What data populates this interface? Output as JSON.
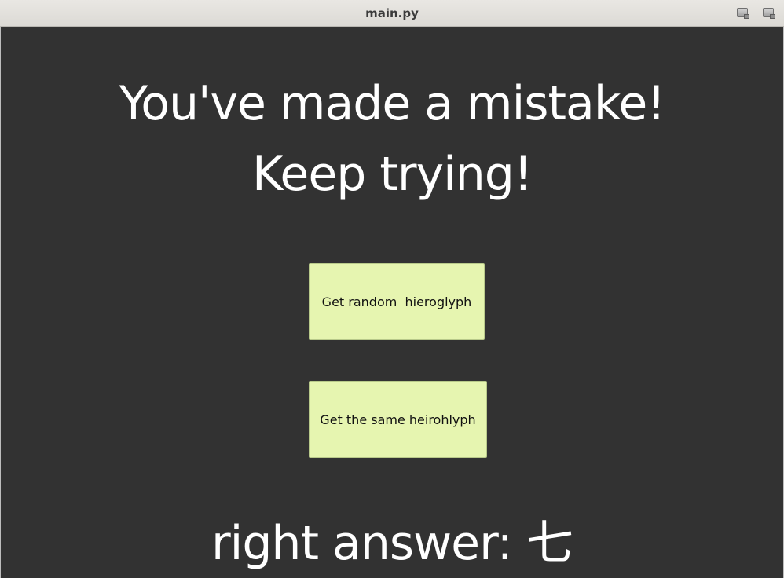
{
  "window": {
    "title": "main.py"
  },
  "message": {
    "line1": "You've made a mistake!",
    "line2": "Keep trying!"
  },
  "buttons": {
    "random_label": "Get random  hieroglyph",
    "same_label": "Get the same heirohlyph"
  },
  "answer": {
    "text": "right answer: 七"
  },
  "colors": {
    "background": "#323232",
    "button": "#e6f5b0",
    "text": "#ffffff"
  }
}
